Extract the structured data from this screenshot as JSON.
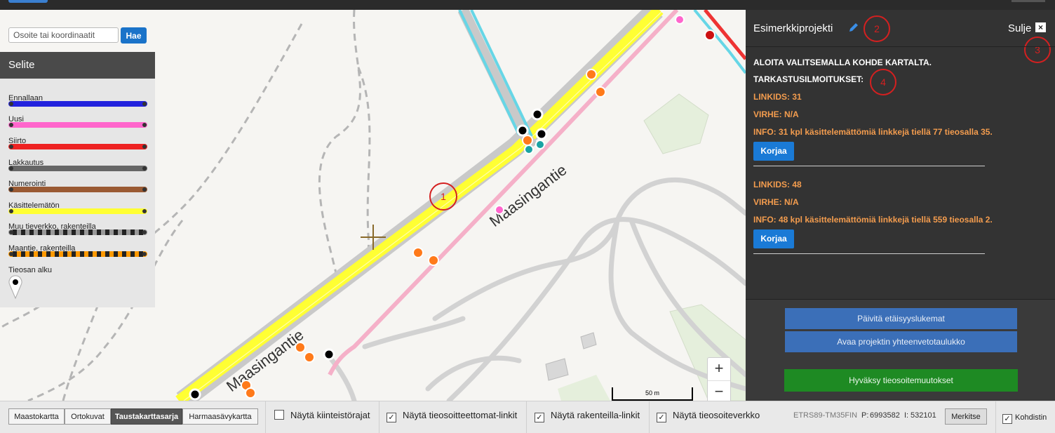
{
  "search": {
    "placeholder": "Osoite tai koordinaatit",
    "button": "Hae"
  },
  "legend": {
    "title": "Selite",
    "items": [
      {
        "label": "Ennallaan",
        "color": "#2222dd"
      },
      {
        "label": "Uusi",
        "color": "#ff66cc"
      },
      {
        "label": "Siirto",
        "color": "#ee2222"
      },
      {
        "label": "Lakkautus",
        "color": "#666666"
      },
      {
        "label": "Numerointi",
        "color": "#9a5a33"
      },
      {
        "label": "Käsittelemätön",
        "color": "#ffff33"
      },
      {
        "label": "Muu tieverkko, rakenteilla",
        "color": "#999999"
      },
      {
        "label": "Maantie, rakenteilla",
        "color": "#ff9900"
      },
      {
        "label": "Tieosan alku",
        "color": "#ffffff"
      }
    ]
  },
  "map": {
    "labels": [
      "Maasingantie",
      "Maasingantie"
    ],
    "annotation": "1",
    "zoom_in": "+",
    "zoom_out": "−",
    "scale": "50 m"
  },
  "panel": {
    "title": "Esimerkkiprojekti",
    "close_label": "Sulje",
    "close_icon": "×",
    "annotations": [
      "2",
      "3",
      "4"
    ],
    "instruction": "ALOITA VALITSEMALLA KOHDE KARTALTA.",
    "notices_heading": "TARKASTUSILMOITUKSET:",
    "notices": [
      {
        "linkids": "LINKIDS: 31",
        "error": "VIRHE: N/A",
        "info": "INFO: 31 kpl käsittelemättömiä linkkejä tiellä 77 tieosalla 35.",
        "button": "Korjaa"
      },
      {
        "linkids": "LINKIDS: 48",
        "error": "VIRHE: N/A",
        "info": "INFO: 48 kpl käsittelemättömiä linkkejä tiellä 559 tieosalla 2.",
        "button": "Korjaa"
      }
    ],
    "buttons": {
      "update": "Päivitä etäisyyslukemat",
      "summary": "Avaa projektin yhteenvetotaulukko",
      "approve": "Hyväksy tieosoitemuutokset"
    }
  },
  "footer": {
    "basemaps": [
      "Maastokartta",
      "Ortokuvat",
      "Taustakarttasarja",
      "Harmaasävykartta"
    ],
    "active_basemap": "Taustakarttasarja",
    "checkboxes": [
      {
        "label": "Näytä kiinteistörajat",
        "checked": false
      },
      {
        "label": "Näytä tieosoitteettomat-linkit",
        "checked": true
      },
      {
        "label": "Näytä rakenteilla-linkit",
        "checked": true
      },
      {
        "label": "Näytä tieosoiteverkko",
        "checked": true
      }
    ],
    "crs": "ETRS89-TM35FIN",
    "p_label": "P:",
    "p_value": "6993582",
    "i_label": "I:",
    "i_value": "532101",
    "mark_button": "Merkitse",
    "target": {
      "label": "Kohdistin",
      "checked": true
    },
    "check_mark": "✓"
  }
}
